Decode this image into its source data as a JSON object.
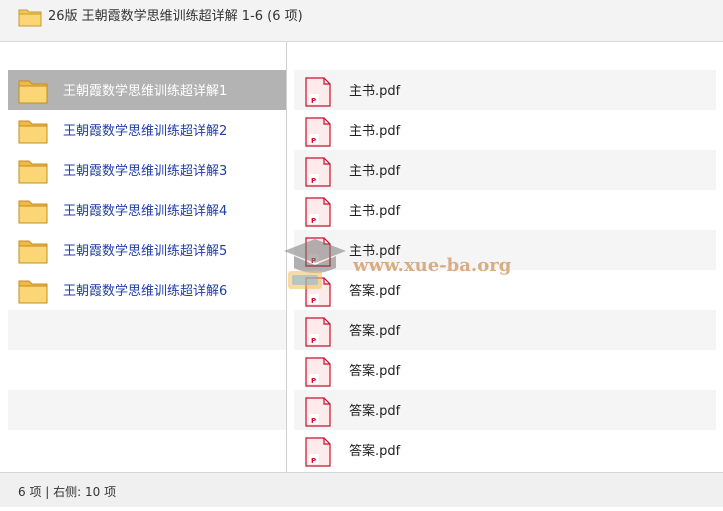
{
  "window": {
    "title": "26版 王朝霞数学思维训练超详解 1-6  (6 项)",
    "title_icon": "folder-icon"
  },
  "left_pane": {
    "items": [
      {
        "label": "王朝霞数学思维训练超详解1",
        "icon": "folder-icon",
        "selected": true
      },
      {
        "label": "王朝霞数学思维训练超详解2",
        "icon": "folder-icon"
      },
      {
        "label": "王朝霞数学思维训练超详解3",
        "icon": "folder-icon"
      },
      {
        "label": "王朝霞数学思维训练超详解4",
        "icon": "folder-icon"
      },
      {
        "label": "王朝霞数学思维训练超详解5",
        "icon": "folder-icon"
      },
      {
        "label": "王朝霞数学思维训练超详解6",
        "icon": "folder-icon"
      }
    ]
  },
  "right_pane": {
    "items": [
      {
        "label": "主书.pdf",
        "icon": "pdf-file-icon"
      },
      {
        "label": "主书.pdf",
        "icon": "pdf-file-icon"
      },
      {
        "label": "主书.pdf",
        "icon": "pdf-file-icon"
      },
      {
        "label": "主书.pdf",
        "icon": "pdf-file-icon"
      },
      {
        "label": "主书.pdf",
        "icon": "pdf-file-icon"
      },
      {
        "label": "答案.pdf",
        "icon": "pdf-file-icon"
      },
      {
        "label": "答案.pdf",
        "icon": "pdf-file-icon"
      },
      {
        "label": "答案.pdf",
        "icon": "pdf-file-icon"
      },
      {
        "label": "答案.pdf",
        "icon": "pdf-file-icon"
      },
      {
        "label": "答案.pdf",
        "icon": "pdf-file-icon"
      }
    ]
  },
  "status_bar": {
    "text": "6 项 | 右侧: 10 项"
  },
  "watermark": {
    "text": "www.xue-ba.org"
  },
  "colors": {
    "selected_row": "#b3b3b3",
    "folder_label": "#1f3ea8",
    "alt_row": "#f5f5f5",
    "folder_fill": "#f7c65a",
    "pdf_accent": "#c8102e"
  }
}
